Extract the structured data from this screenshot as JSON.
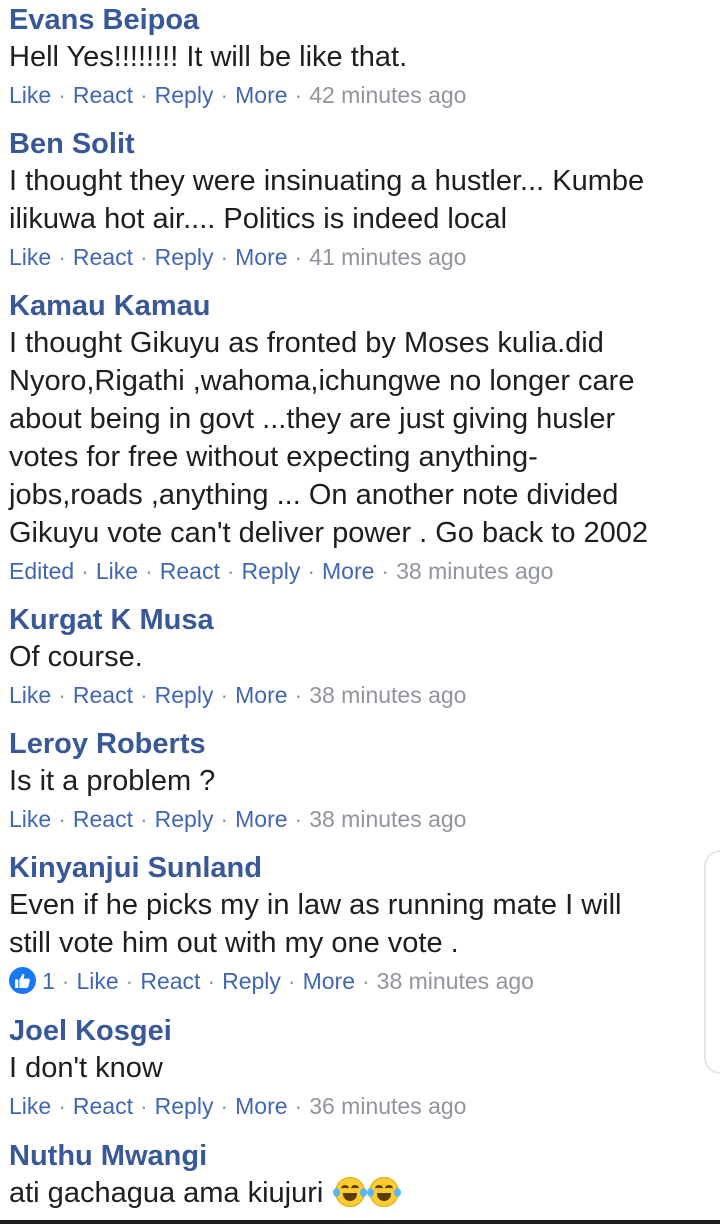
{
  "comments": [
    {
      "author": "Evans Beipoa",
      "lines": [
        "Hell Yes!!!!!!!! It will be like that."
      ],
      "edited": "",
      "likes": "",
      "actions": [
        "Like",
        "React",
        "Reply",
        "More"
      ],
      "time": "42 minutes ago"
    },
    {
      "author": "Ben Solit",
      "lines": [
        "I thought they were insinuating a hustler... Kumbe",
        "ilikuwa hot air.... Politics is indeed local"
      ],
      "edited": "",
      "likes": "",
      "actions": [
        "Like",
        "React",
        "Reply",
        "More"
      ],
      "time": "41 minutes ago"
    },
    {
      "author": "Kamau Kamau",
      "lines": [
        "I thought Gikuyu as fronted by Moses kulia.did",
        "Nyoro,Rigathi ,wahoma,ichungwe no longer care",
        "about being in govt ...they are just giving husler",
        "votes for free without expecting anything-",
        "jobs,roads ,anything ... On another note divided",
        "Gikuyu vote can't deliver power . Go back to 2002"
      ],
      "edited": "Edited",
      "likes": "",
      "actions": [
        "Like",
        "React",
        "Reply",
        "More"
      ],
      "time": "38 minutes ago"
    },
    {
      "author": "Kurgat K Musa",
      "lines": [
        "Of course."
      ],
      "edited": "",
      "likes": "",
      "actions": [
        "Like",
        "React",
        "Reply",
        "More"
      ],
      "time": "38 minutes ago"
    },
    {
      "author": "Leroy Roberts",
      "lines": [
        "Is it a problem ?"
      ],
      "edited": "",
      "likes": "",
      "actions": [
        "Like",
        "React",
        "Reply",
        "More"
      ],
      "time": "38 minutes ago"
    },
    {
      "author": "Kinyanjui Sunland",
      "lines": [
        "Even if he picks my in law as running mate I will",
        "still vote him out with my one vote ."
      ],
      "edited": "",
      "likes": "1",
      "actions": [
        "Like",
        "React",
        "Reply",
        "More"
      ],
      "time": "38 minutes ago"
    },
    {
      "author": "Joel Kosgei",
      "lines": [
        "I don't know"
      ],
      "edited": "",
      "likes": "",
      "actions": [
        "Like",
        "React",
        "Reply",
        "More"
      ],
      "time": "36 minutes ago"
    },
    {
      "author": "Nuthu Mwangi",
      "lines": [
        "ati gachagua ama kiujuri"
      ],
      "edited": "",
      "likes": "",
      "actions": [],
      "time": "",
      "emoji": [
        "tears-of-joy-icon",
        "tears-of-joy-icon"
      ]
    }
  ],
  "colors": {
    "author": "#385898",
    "action": "#4267b2",
    "meta": "#90949c",
    "text": "#1c1e21",
    "like_badge": "#1877f2"
  }
}
